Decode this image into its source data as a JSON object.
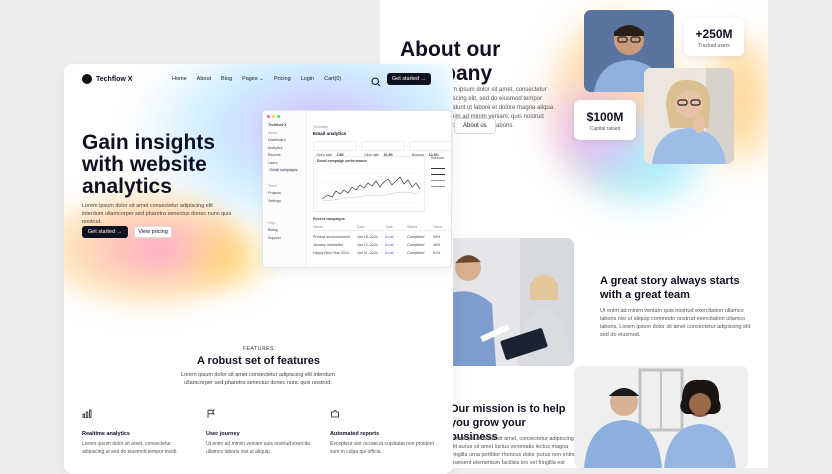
{
  "about": {
    "title": "About our company",
    "text": "Lorem ipsum dolor sit amet, consectetur adipiscing elit, sed do eiusmod tempor incididunt ut labore et dolore magna aliqua. Ut enim ad minim veniam, quis nostrud exercitation ullamco laboris.",
    "button": "About us",
    "stats": [
      {
        "value": "+250M",
        "label": "Tracked users"
      },
      {
        "value": "$100M",
        "label": "Capital raised"
      }
    ]
  },
  "story": {
    "title": "A great story always starts with a great team",
    "text": "Ut enim ad minim veniam quis nostrud exercitation ullamco laboris nisi ut aliquip commodo nostrud exercitation ullamco laboris. Lorem ipsum dolor sit amet consectetur adipiscing elit sed do eiusmod."
  },
  "mission": {
    "title": "Our mission is to help you grow your business",
    "text": "Lorem ipsum dolor sit amet, consectetur adipiscing elit aurus sit amet luctus venenatis lectus magna fringilla urna porttitor rhoncus dolor purus non enim praesent elementum facilisis leo vel fringilla est ullamcorper eget nulla facilisi etiam dignissim diam."
  },
  "nav": {
    "brand": "Techflow X",
    "links": [
      "Home",
      "About",
      "Blog",
      "Pages",
      "Pricing",
      "Login",
      "Cart(0)"
    ],
    "cta": "Get started"
  },
  "hero": {
    "title": "Gain insights with website analytics",
    "text": "Lorem ipsum dolor sit amet consectetur adipiscing elit interdum ullamcorper sed pharetra senectus donec nunc quis nostrud.",
    "primary": "Get started",
    "secondary": "View pricing"
  },
  "dashboard": {
    "brand": "Techflow X",
    "page_title": "Overview",
    "page_heading": "Email analytics",
    "sidebar": [
      "Dashboard",
      "Analytics",
      "Reports",
      "Users",
      "Email campaigns",
      "Projects",
      "Settings",
      "Billing",
      "Support"
    ],
    "sidebar_groups": [
      "Menu",
      "Team",
      "Help"
    ],
    "stats": [
      {
        "label": "Open rate",
        "value": "2.8K"
      },
      {
        "label": "Click rate",
        "value": "16.5K"
      },
      {
        "label": "Bounce",
        "value": "12.8%"
      }
    ],
    "chart_title": "Email campaign performance",
    "chart_legend": "Sources",
    "table_title": "Recent campaigns",
    "table_headers": [
      "Name",
      "Date",
      "Type",
      "Status",
      "Open"
    ],
    "table_rows": [
      [
        "Product announcement",
        "Jan 18, 2024",
        "Email",
        "Completed",
        "54%"
      ],
      [
        "January newsletter",
        "Jan 12, 2024",
        "Email",
        "Completed",
        "48%"
      ],
      [
        "Happy New Year 2024",
        "Jan 01, 2024",
        "Email",
        "Completed",
        "61%"
      ]
    ]
  },
  "features": {
    "overline": "FEATURES",
    "title": "A robust set of features",
    "text": "Lorem ipsum dolor sit amet consectetur adipiscing elit interdum ullamcorper sed pharetra senectus donec nunc quis nostrud.",
    "items": [
      {
        "icon": "bar-chart-icon",
        "title": "Realtime analytics",
        "text": "Lorem ipsum dolor sit amet, consectetur adipiscing ut sed do eiusmod tempor incidi."
      },
      {
        "icon": "flag-icon",
        "title": "User journey",
        "text": "Ut enim ad minim veniam quis nostrud exercita ullamco laboris nisi ut aliquip."
      },
      {
        "icon": "puzzle-icon",
        "title": "Automated reports",
        "text": "Excepteur sint occaecat cupidatat non proident sunt in culpa qui officia."
      }
    ]
  },
  "colors": {
    "dark": "#0f1020",
    "accent_pink": "#ff8fb8",
    "accent_purple": "#c8a8ff",
    "accent_orange": "#ffc56b",
    "accent_cyan": "#8fe3f7"
  }
}
